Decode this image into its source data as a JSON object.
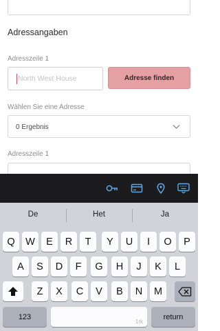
{
  "form": {
    "section_title": "Adressangaben",
    "address_line_label": "Adresszeile 1",
    "address_input_placeholder": "North West House",
    "find_button_label": "Adresse finden",
    "select_label": "Wählen Sie eine Adresse",
    "select_value": "0 Ergebnis",
    "address_line_label_2": "Adresszeile 1"
  },
  "accessory_icons": [
    "key-icon",
    "credit-card-icon",
    "location-pin-icon",
    "keyboard-icon"
  ],
  "keyboard": {
    "predictions": [
      "De",
      "Het",
      "Ja"
    ],
    "row1": [
      "Q",
      "W",
      "E",
      "R",
      "T",
      "Y",
      "U",
      "I",
      "O",
      "P"
    ],
    "row2": [
      "A",
      "S",
      "D",
      "F",
      "G",
      "H",
      "J",
      "K",
      "L"
    ],
    "row3": [
      "Z",
      "X",
      "C",
      "V",
      "B",
      "N",
      "M"
    ],
    "numbers_label": "123",
    "return_label": "return",
    "space_hint": "1rk"
  }
}
